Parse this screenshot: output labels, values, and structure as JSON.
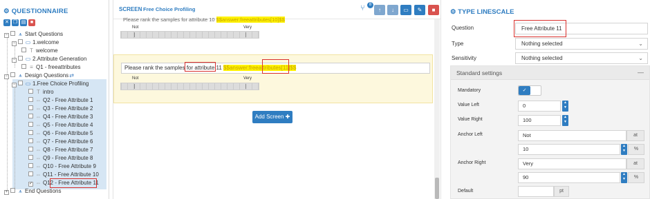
{
  "left_panel": {
    "title": "QUESTIONNAIRE",
    "tree": [
      {
        "label": "Start Questions",
        "icon": "sitemap-icon"
      },
      {
        "label": "1.welcome",
        "icon": "monitor-icon"
      },
      {
        "label": "welcome",
        "icon": "text-icon"
      },
      {
        "label": "2.Attribute Generation",
        "icon": "monitor-icon"
      },
      {
        "label": "Q1 - freeattributes",
        "icon": "list-icon"
      },
      {
        "label": "Design Questions",
        "icon": "sitemap-icon"
      },
      {
        "label": "1.Free Choice Profiling",
        "icon": "monitor-icon"
      },
      {
        "label": "intro",
        "icon": "text-icon"
      },
      {
        "label": "Q2 - Free Attribute 1",
        "icon": "linescale-icon"
      },
      {
        "label": "Q3 - Free Attribute 2",
        "icon": "linescale-icon"
      },
      {
        "label": "Q4 - Free Attribute 3",
        "icon": "linescale-icon"
      },
      {
        "label": "Q5 - Free Attribute 4",
        "icon": "linescale-icon"
      },
      {
        "label": "Q6 - Free Attribute 5",
        "icon": "linescale-icon"
      },
      {
        "label": "Q7 - Free Attribute 6",
        "icon": "linescale-icon"
      },
      {
        "label": "Q8 - Free Attribute 7",
        "icon": "linescale-icon"
      },
      {
        "label": "Q9 - Free Attribute 8",
        "icon": "linescale-icon"
      },
      {
        "label": "Q10 - Free Attribute 9",
        "icon": "linescale-icon"
      },
      {
        "label": "Q11 - Free Attribute 10",
        "icon": "linescale-icon"
      },
      {
        "label": "Q12 - Free Attribute 11",
        "icon": "linescale-icon"
      },
      {
        "label": "End Questions",
        "icon": "sitemap-icon"
      }
    ]
  },
  "middle_panel": {
    "heading": "SCREEN",
    "subheading": "Free Choice Profiling",
    "header_badge": "8",
    "prev_question_text": "Please rank the samples for attribute 10 ",
    "prev_question_placeholder": "$$answer:freeattributes[10]$$",
    "prev_scale_left": "Not",
    "prev_scale_right": "Very",
    "question_text": "Please rank the samples for attribute 11 ",
    "question_placeholder": "$$answer:freeattributes[11]$$",
    "scale_left": "Not",
    "scale_right": "Very",
    "add_screen_label": "Add Screen"
  },
  "right_panel": {
    "title": "TYPE LINESCALE",
    "question_label": "Question",
    "question_value": "Free Attribute 11",
    "type_label": "Type",
    "type_value": "Nothing selected",
    "sensitivity_label": "Sensitivity",
    "sensitivity_value": "Nothing selected",
    "standard_settings": "Standard settings",
    "mandatory_label": "Mandatory",
    "mandatory_on": true,
    "value_left_label": "Value Left",
    "value_left": "0",
    "value_right_label": "Value Right",
    "value_right": "100",
    "anchor_left_label": "Anchor Left",
    "anchor_left_text": "Not",
    "anchor_left_pos": "10",
    "anchor_right_label": "Anchor Right",
    "anchor_right_text": "Very",
    "anchor_right_pos": "90",
    "default_label": "Default",
    "default_value": "",
    "at_label": "at",
    "percent_label": "%",
    "pt_label": "pt"
  }
}
